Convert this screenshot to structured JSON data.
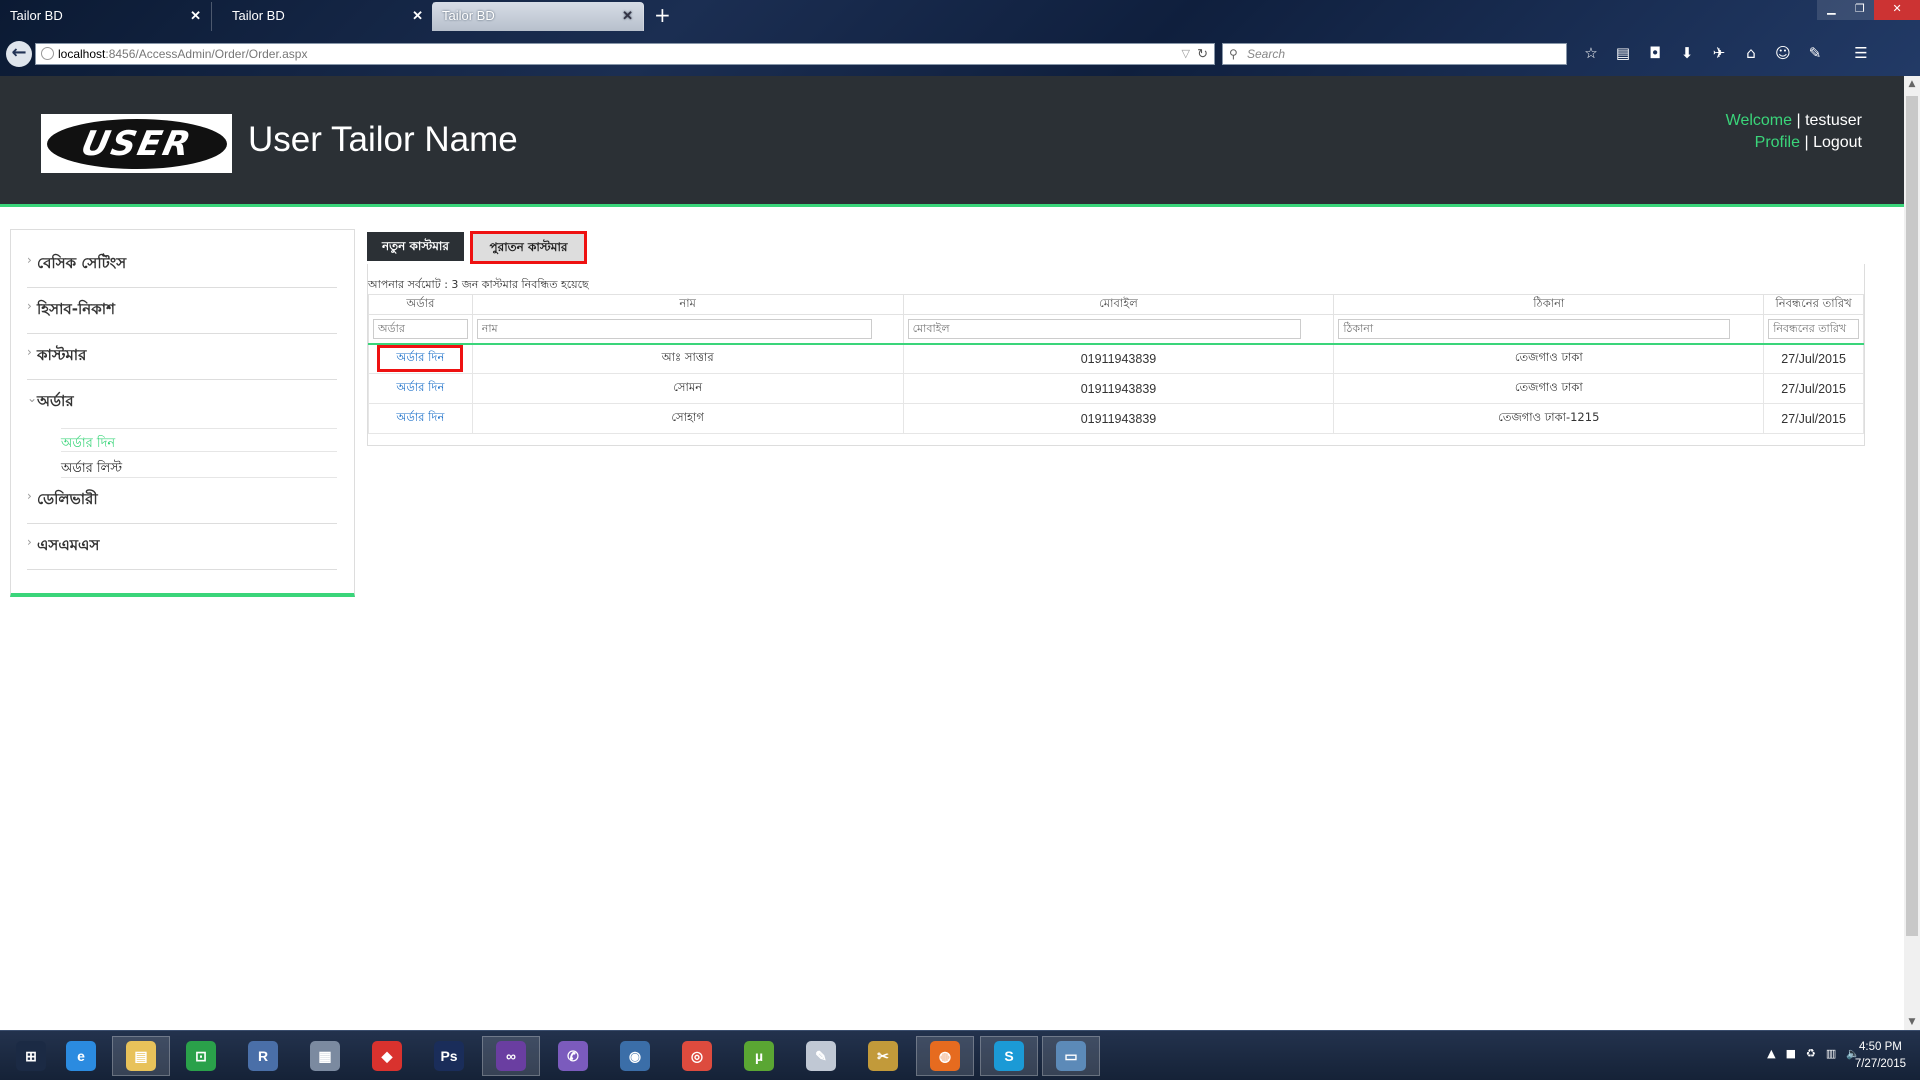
{
  "browser": {
    "tabs": [
      {
        "title": "Tailor BD"
      },
      {
        "title": "Tailor BD"
      },
      {
        "title": "Tailor BD"
      }
    ],
    "new_tab_label": "+",
    "url_host": "localhost",
    "url_path": ":8456/AccessAdmin/Order/Order.aspx",
    "search_placeholder": "Search",
    "toolbar_icons": [
      "bookmark-star-icon",
      "reading-list-icon",
      "pocket-icon",
      "download-icon",
      "bird-extension-icon",
      "home-icon",
      "chat-icon",
      "pen-icon",
      "menu-icon"
    ]
  },
  "header": {
    "logo_text": "USER",
    "site_name": "User Tailor Name",
    "welcome_label": "Welcome",
    "username": "testuser",
    "profile_label": "Profile",
    "logout_label": "Logout",
    "separator": "|"
  },
  "sidebar": {
    "items": [
      {
        "label": "বেসিক সেটিংস"
      },
      {
        "label": "হিসাব-নিকাশ"
      },
      {
        "label": "কাস্টমার"
      },
      {
        "label": "অর্ডার",
        "expanded": true,
        "children": [
          {
            "label": "অর্ডার দিন",
            "active": true
          },
          {
            "label": "অর্ডার লিস্ট"
          }
        ]
      },
      {
        "label": "ডেলিভারী"
      },
      {
        "label": "এসএমএস"
      }
    ]
  },
  "main": {
    "new_customer_button": "নতুন কাস্টমার",
    "old_customer_button": "পুরাতন কাস্টমার",
    "total_text": "আপনার সর্বমোট : 3 জন কাস্টমার নিবন্ধিত হয়েছে",
    "table": {
      "columns": [
        "অর্ডার",
        "নাম",
        "মোবাইল",
        "ঠিকানা",
        "নিবন্ধনের তারিখ"
      ],
      "filters": [
        "অর্ডার",
        "নাম",
        "মোবাইল",
        "ঠিকানা",
        "নিবন্ধনের তারিখ"
      ],
      "rows": [
        {
          "action": "অর্ডার দিন",
          "name": "আঃ সাত্তার",
          "mobile": "01911943839",
          "address": "তেজগাও ঢাকা",
          "date": "27/Jul/2015"
        },
        {
          "action": "অর্ডার দিন",
          "name": "সোমন",
          "mobile": "01911943839",
          "address": "তেজগাও ঢাকা",
          "date": "27/Jul/2015"
        },
        {
          "action": "অর্ডার দিন",
          "name": "সোহাগ",
          "mobile": "01911943839",
          "address": "তেজগাও ঢাকা-1215",
          "date": "27/Jul/2015"
        }
      ]
    }
  },
  "taskbar": {
    "apps": [
      {
        "icon": "windows-start-icon",
        "glyph": "⊞",
        "color": "#1b2a44"
      },
      {
        "icon": "internet-explorer-icon",
        "glyph": "e",
        "color": "#2b8be0"
      },
      {
        "icon": "file-explorer-icon",
        "glyph": "▤",
        "color": "#e8c25a"
      },
      {
        "icon": "store-icon",
        "glyph": "⊡",
        "color": "#2aa14a"
      },
      {
        "icon": "r-studio-icon",
        "glyph": "R",
        "color": "#4a6fa8"
      },
      {
        "icon": "calculator-icon",
        "glyph": "▦",
        "color": "#7b8aa0"
      },
      {
        "icon": "anydesk-icon",
        "glyph": "◆",
        "color": "#d9322e"
      },
      {
        "icon": "photoshop-icon",
        "glyph": "Ps",
        "color": "#1a2d5a"
      },
      {
        "icon": "visual-studio-icon",
        "glyph": "∞",
        "color": "#6a3ea1"
      },
      {
        "icon": "viber-icon",
        "glyph": "✆",
        "color": "#7b5bbd"
      },
      {
        "icon": "network-tool-icon",
        "glyph": "◉",
        "color": "#3b6ea8"
      },
      {
        "icon": "chrome-icon",
        "glyph": "◎",
        "color": "#dd4b3e"
      },
      {
        "icon": "utorrent-icon",
        "glyph": "µ",
        "color": "#5aa633"
      },
      {
        "icon": "paint-icon",
        "glyph": "✎",
        "color": "#c0c8d4"
      },
      {
        "icon": "tools-icon",
        "glyph": "✂",
        "color": "#c29a3a"
      },
      {
        "icon": "firefox-icon",
        "glyph": "◍",
        "color": "#e66b1f"
      },
      {
        "icon": "skype-icon",
        "glyph": "S",
        "color": "#1b9ad6"
      },
      {
        "icon": "remote-desktop-icon",
        "glyph": "▭",
        "color": "#5c8ab8"
      }
    ],
    "time": "4:50 PM",
    "date": "7/27/2015"
  },
  "colors": {
    "accent_green": "#3ad57a",
    "header_dark": "#2b3035",
    "highlight_red": "#ee1111",
    "link_blue": "#1a6fc9"
  }
}
